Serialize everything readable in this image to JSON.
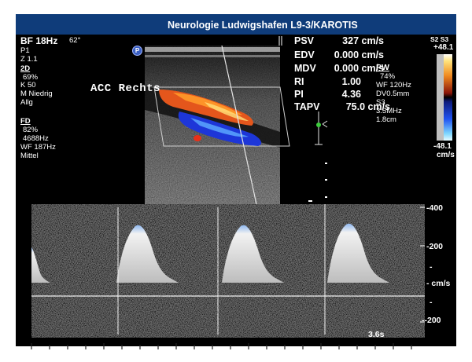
{
  "header": {
    "title": "Neurologie Ludwigshafen   L9-3/KAROTIS"
  },
  "left_panel": {
    "bf": "BF 18Hz",
    "angle": "62°",
    "p": "P1",
    "zoom": "Z 1.1",
    "mode_2d": "2D",
    "gain_2d": "69%",
    "k": "K 50",
    "m": "M Niedrig",
    "allg": "Allg",
    "mode_fd": "FD",
    "gain_fd": "82%",
    "freq": "4688Hz",
    "wf": "WF 187Hz",
    "mittel": "Mittel"
  },
  "image_label": "ACC  Rechts",
  "p_marker": "P",
  "measurements": [
    {
      "name": "PSV",
      "value": "327 cm/s"
    },
    {
      "name": "EDV",
      "value": "0.000 cm/s"
    },
    {
      "name": "MDV",
      "value": "0.000 cm/s"
    },
    {
      "name": "RI",
      "value": "1.00"
    },
    {
      "name": "PI",
      "value": "4.36"
    },
    {
      "name": "TAPV",
      "value": "75.0 cm/s"
    }
  ],
  "pw_panel": {
    "title": "PW",
    "gain": "74%",
    "wf": "WF 120Hz",
    "dv": "DV0.5mm",
    "s": "S3",
    "freq": "3.5MHz",
    "depth": "1.8cm"
  },
  "color_scale": {
    "label": "S2 S3",
    "max": "+48.1",
    "min": "-48.1",
    "unit": "cm/s"
  },
  "doppler": {
    "ticks": [
      "-400",
      "-200",
      "-",
      "- cm/s",
      "-",
      "--200"
    ],
    "time": "3.6s"
  },
  "colors": {
    "header_bg": "#0f3c7a",
    "screen_bg": "#000000",
    "spectrum": "#8fb8f0"
  }
}
